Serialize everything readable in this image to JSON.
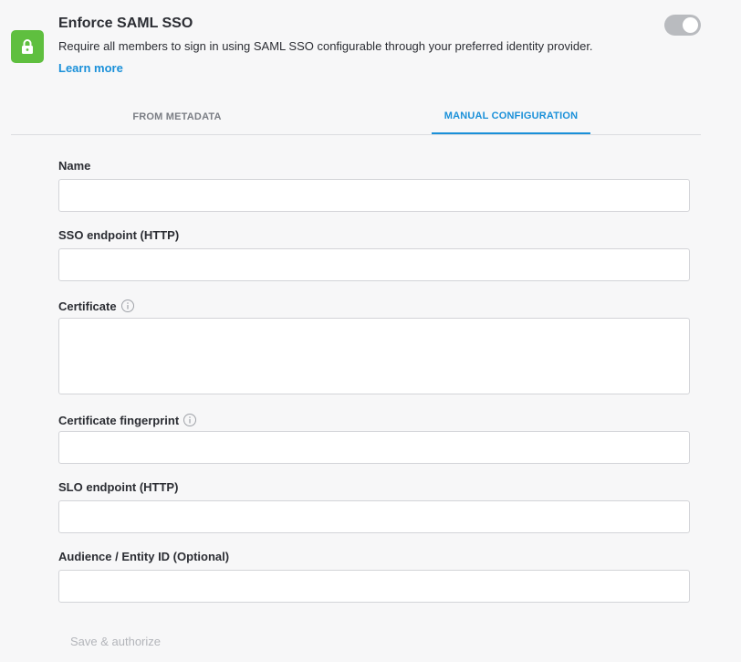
{
  "header": {
    "title": "Enforce SAML SSO",
    "description": "Require all members to sign in using SAML SSO configurable through your preferred identity provider.",
    "learn_more": "Learn more",
    "lock_color": "#5fbf3f",
    "toggle_enabled": false
  },
  "tabs": [
    {
      "label": "FROM METADATA",
      "active": false
    },
    {
      "label": "MANUAL CONFIGURATION",
      "active": true
    }
  ],
  "form": {
    "name": {
      "label": "Name",
      "value": ""
    },
    "sso_endpoint": {
      "label": "SSO endpoint (HTTP)",
      "value": ""
    },
    "certificate": {
      "label": "Certificate",
      "value": ""
    },
    "certificate_fingerprint": {
      "label": "Certificate fingerprint",
      "value": ""
    },
    "slo_endpoint": {
      "label": "SLO endpoint (HTTP)",
      "value": ""
    },
    "audience": {
      "label": "Audience / Entity ID (Optional)",
      "value": ""
    },
    "save_label": "Save & authorize"
  },
  "colors": {
    "accent": "#1a90d9",
    "background": "#f7f7f8"
  }
}
